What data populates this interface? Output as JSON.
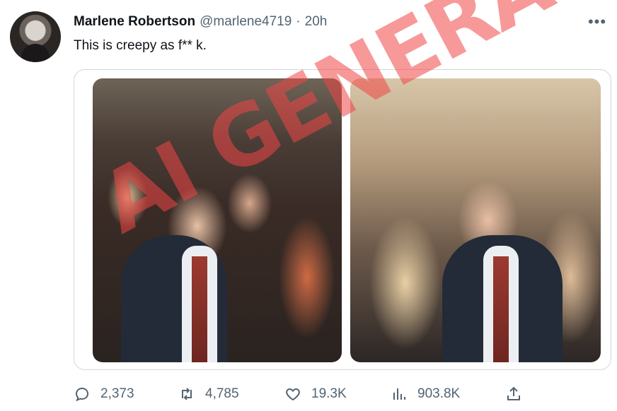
{
  "tweet": {
    "author_name": "Marlene Robertson",
    "handle": "@marlene4719",
    "separator": "·",
    "time": "20h",
    "more_label": "•••",
    "text": "This is creepy as f** k."
  },
  "media": {
    "watermark": "AI GENERATED"
  },
  "actions": {
    "replies": "2,373",
    "retweets": "4,785",
    "likes": "19.3K",
    "views": "903.8K"
  },
  "icons": {
    "reply": "reply-icon",
    "retweet": "retweet-icon",
    "like": "heart-icon",
    "views": "views-icon",
    "share": "share-icon"
  }
}
